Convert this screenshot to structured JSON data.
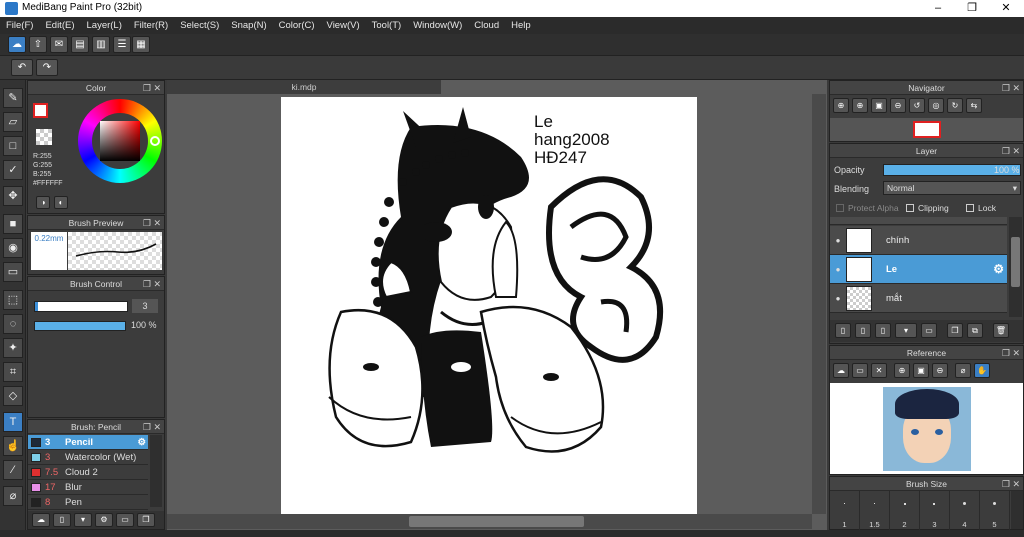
{
  "app": {
    "title": "MediBang Paint Pro (32bit)"
  },
  "window_controls": [
    "–",
    "❐",
    "✕"
  ],
  "menu": [
    "File(F)",
    "Edit(E)",
    "Layer(L)",
    "Filter(R)",
    "Select(S)",
    "Snap(N)",
    "Color(C)",
    "View(V)",
    "Tool(T)",
    "Window(W)",
    "Cloud",
    "Help"
  ],
  "document": {
    "tab": "ki.mdp",
    "text_lines": [
      "Le",
      "hang2008",
      "HĐ247"
    ]
  },
  "color_panel": {
    "title": "Color",
    "r": "R:255",
    "g": "G:255",
    "b": "B:255",
    "hex": "#FFFFFF"
  },
  "brush_preview": {
    "title": "Brush Preview",
    "size": "0.22mm"
  },
  "brush_control": {
    "title": "Brush Control",
    "size_value": "3",
    "opacity_value": "100 %",
    "opacity_fraction": 1.0
  },
  "brush_list": {
    "title": "Brush: Pencil",
    "items": [
      {
        "size": "3",
        "name": "Pencil",
        "color": "#1e2a3a",
        "selected": true
      },
      {
        "size": "3",
        "name": "Watercolor (Wet)",
        "color": "#7ecfe8",
        "selected": false
      },
      {
        "size": "7.5",
        "name": "Cloud 2",
        "color": "#e03030",
        "selected": false
      },
      {
        "size": "17",
        "name": "Blur",
        "color": "#e890e8",
        "selected": false
      },
      {
        "size": "8",
        "name": "Pen",
        "color": "#222222",
        "selected": false
      }
    ]
  },
  "navigator": {
    "title": "Navigator"
  },
  "layer_panel": {
    "title": "Layer",
    "opacity_label": "Opacity",
    "opacity_value": "100 %",
    "opacity_fraction": 1.0,
    "blending_label": "Blending",
    "blending_value": "Normal",
    "protect_alpha": "Protect Alpha",
    "clipping": "Clipping",
    "lock": "Lock",
    "layers": [
      {
        "name": "chính",
        "selected": false
      },
      {
        "name": "Le",
        "selected": true
      },
      {
        "name": "mắt",
        "selected": false
      }
    ]
  },
  "reference": {
    "title": "Reference"
  },
  "brush_size": {
    "title": "Brush Size",
    "sizes": [
      "1",
      "1.5",
      "2",
      "3",
      "4",
      "5"
    ]
  },
  "colors": {
    "accent": "#3b8fd9",
    "selected_row": "#4a9bd6",
    "panel": "#3c3c3c"
  }
}
